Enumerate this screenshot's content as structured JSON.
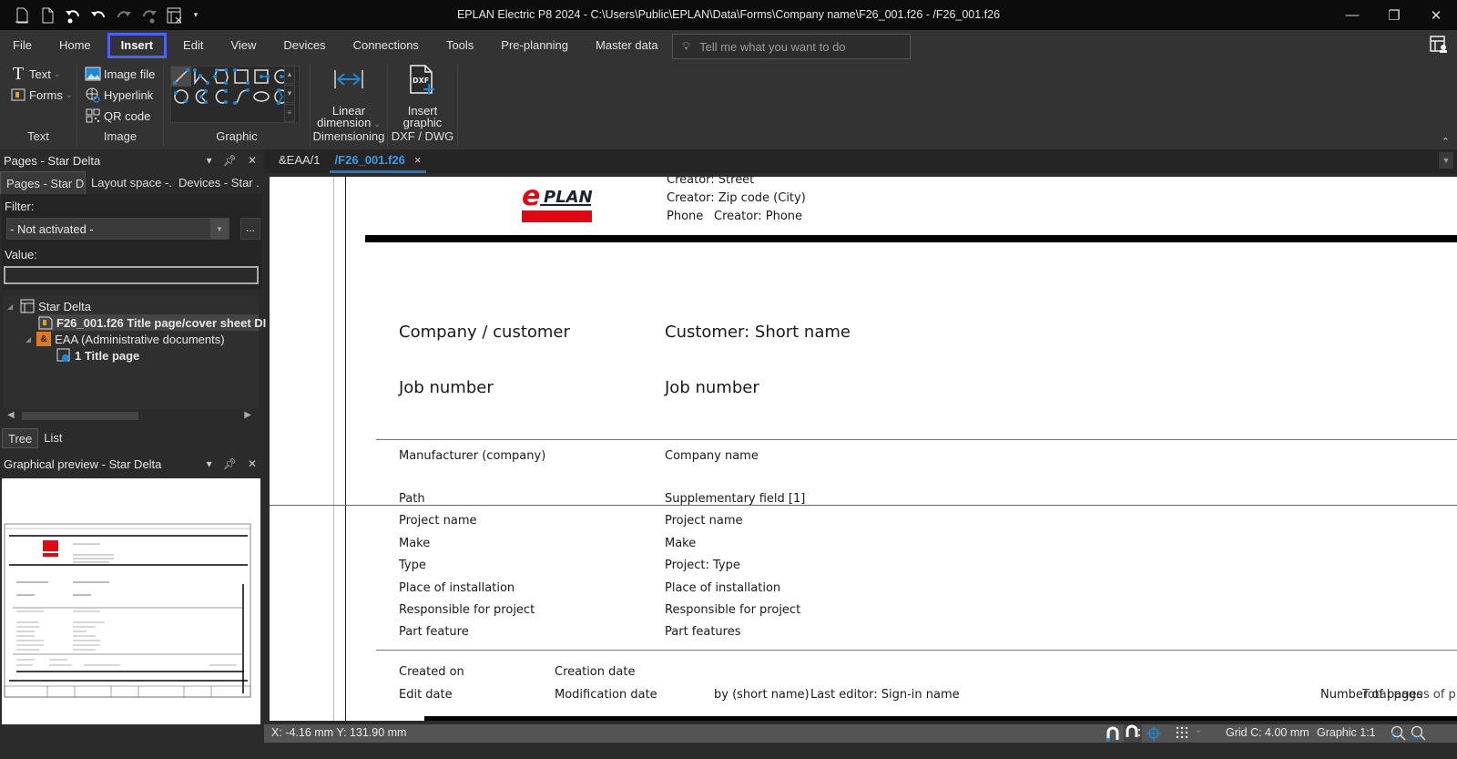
{
  "titlebar": {
    "title": "EPLAN Electric P8 2024 - C:\\Users\\Public\\EPLAN\\Data\\Forms\\Company name\\F26_001.f26 - /F26_001.f26",
    "quick_access": [
      "new-page-icon",
      "page-properties-icon",
      "undo-list-icon",
      "undo-icon",
      "redo-icon",
      "redo-list-icon",
      "layout-icon",
      "customize-icon"
    ],
    "controls": {
      "minimize": "—",
      "restore": "❐",
      "close": "✕"
    }
  },
  "menu": {
    "items": [
      "File",
      "Home",
      "Insert",
      "Edit",
      "View",
      "Devices",
      "Connections",
      "Tools",
      "Pre-planning",
      "Master data"
    ],
    "active": "Insert",
    "tell_me_placeholder": "Tell me what you want to do"
  },
  "ribbon": {
    "text_group": {
      "label": "Text",
      "buttons": [
        "Text",
        "Forms"
      ]
    },
    "image_group": {
      "label": "Image",
      "buttons": [
        "Image file",
        "Hyperlink",
        "QR code"
      ]
    },
    "graphic_group": {
      "label": "Graphic",
      "shapes": [
        "line",
        "polyline",
        "polygon",
        "rectangle",
        "rectangle-center",
        "circle-center",
        "circle",
        "circle-arc",
        "arc-center",
        "spline",
        "ellipse",
        "sector"
      ]
    },
    "dimensioning_group": {
      "label": "Dimensioning",
      "button_line1": "Linear",
      "button_line2": "dimension"
    },
    "dxf_group": {
      "label": "DXF / DWG",
      "button_line1": "Insert",
      "button_line2": "graphic",
      "icon_text": "DXF"
    }
  },
  "pages_panel": {
    "title": "Pages - Star Delta",
    "tabs": [
      "Pages - Star D...",
      "Layout space -...",
      "Devices - Star ..."
    ],
    "filter_label": "Filter:",
    "filter_value": "- Not activated -",
    "more_button": "...",
    "value_label": "Value:",
    "value": "",
    "tree": [
      {
        "label": "Star Delta",
        "bold": false,
        "level": 0
      },
      {
        "label": "F26_001.f26 Title page/cover sheet DI",
        "bold": true,
        "level": 1,
        "selected": true
      },
      {
        "label": "EAA (Administrative documents)",
        "bold": false,
        "level": 1
      },
      {
        "label": "1 Title page",
        "bold": true,
        "level": 2
      }
    ],
    "bottom_tabs": [
      "Tree",
      "List"
    ],
    "active_bottom_tab": "Tree"
  },
  "preview_panel": {
    "title": "Graphical preview - Star Delta"
  },
  "editor": {
    "tabs": [
      {
        "label": "&EAA/1",
        "active": false
      },
      {
        "label": "/F26_001.f26",
        "active": true,
        "close": "×"
      }
    ],
    "document": {
      "logo_text": "PLAN",
      "logo_e": "e",
      "creator_lines": [
        "Creator: Street",
        "Creator: Zip code (City)"
      ],
      "phone_label": "Phone",
      "phone_value": "Creator: Phone",
      "big_rows": [
        {
          "label": "Company / customer",
          "value": "Customer: Short name"
        },
        {
          "label": "Job number",
          "value": "Job number"
        }
      ],
      "manufacturer": {
        "label": "Manufacturer (company)",
        "value": "Company name"
      },
      "rows": [
        {
          "label": "Path",
          "value": "Supplementary field [1]"
        },
        {
          "label": "Project name",
          "value": "Project name"
        },
        {
          "label": "Make",
          "value": "Make"
        },
        {
          "label": "Type",
          "value": "Project: Type"
        },
        {
          "label": "Place of installation",
          "value": "Place of installation"
        },
        {
          "label": "Responsible for project",
          "value": "Responsible for project"
        },
        {
          "label": "Part feature",
          "value": "Part features"
        }
      ],
      "created_on": {
        "label": "Created on",
        "value": "Creation date"
      },
      "edit_date": {
        "label": "Edit date",
        "value": "Modification date",
        "by_label": "by (short name)",
        "by_value": "Last editor: Sign-in name"
      },
      "pages_text": "Number of pages",
      "pages_overlap": "Total pages of p"
    }
  },
  "statusbar": {
    "coordinates": "X: -4.16 mm Y: 131.90 mm",
    "grid": "Grid C: 4.00 mm",
    "scale": "Graphic 1:1"
  },
  "colors": {
    "accent": "#4f61f5",
    "tab_active": "#3a9be8",
    "icon_blue": "#1e88d8",
    "logo_red": "#e30613"
  }
}
